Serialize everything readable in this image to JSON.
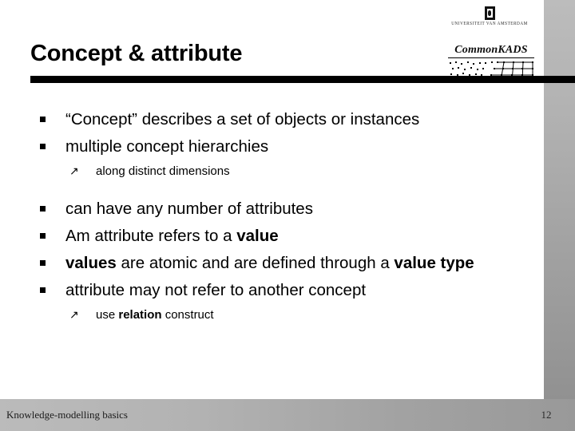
{
  "slide": {
    "title": "Concept & attribute",
    "accent_color": "#000000",
    "background_color": "#ffffff",
    "strip_color": "#b2b2b2"
  },
  "logos": {
    "university": {
      "name": "uva-logo",
      "text": "UNIVERSITEIT VAN AMSTERDAM"
    },
    "method": {
      "name": "commonkads-logo",
      "text": "CommonKADS"
    }
  },
  "content": {
    "bullets": [
      {
        "level": 1,
        "marker": "square-bullet",
        "runs": [
          {
            "text": "“Concept” describes a set of objects or instances",
            "bold": false
          }
        ]
      },
      {
        "level": 1,
        "marker": "square-bullet",
        "runs": [
          {
            "text": "multiple concept hierarchies",
            "bold": false
          }
        ]
      },
      {
        "level": 2,
        "marker": "arrow-bullet",
        "runs": [
          {
            "text": "along distinct dimensions",
            "bold": false
          }
        ]
      },
      {
        "level": 1,
        "marker": "square-bullet",
        "runs": [
          {
            "text": "can have any number of attributes",
            "bold": false
          }
        ]
      },
      {
        "level": 1,
        "marker": "square-bullet",
        "runs": [
          {
            "text": "Am attribute refers to a ",
            "bold": false
          },
          {
            "text": "value",
            "bold": true
          }
        ]
      },
      {
        "level": 1,
        "marker": "square-bullet",
        "runs": [
          {
            "text": "values",
            "bold": true
          },
          {
            "text": " are atomic and are defined through a ",
            "bold": false
          },
          {
            "text": "value type",
            "bold": true
          }
        ]
      },
      {
        "level": 1,
        "marker": "square-bullet",
        "runs": [
          {
            "text": "attribute may not refer to another concept",
            "bold": false
          }
        ]
      },
      {
        "level": 2,
        "marker": "arrow-bullet",
        "runs": [
          {
            "text": "use ",
            "bold": false
          },
          {
            "text": "relation",
            "bold": true
          },
          {
            "text": " construct",
            "bold": false
          }
        ]
      }
    ],
    "square_marker_glyph": "■",
    "arrow_marker_glyph": "↗"
  },
  "footer": {
    "label": "Knowledge-modelling basics",
    "page_number": "12"
  }
}
